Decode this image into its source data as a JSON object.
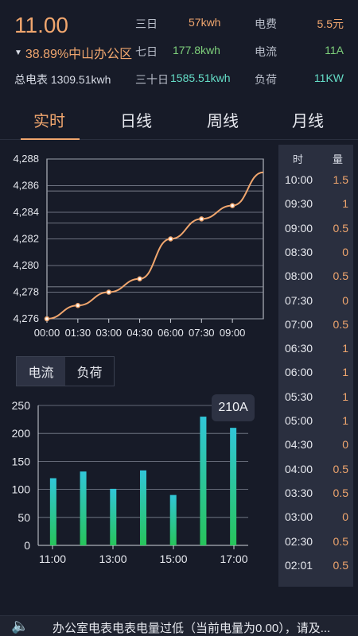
{
  "header": {
    "main_value": "11.00",
    "percent_location": "38.89%中山办公区",
    "total_meter": "总电表 1309.51kwh",
    "stats": [
      {
        "label": "三日",
        "value": "57kwh",
        "color": "orange"
      },
      {
        "label": "七日",
        "value": "177.8kwh",
        "color": "green"
      },
      {
        "label": "三十日",
        "value": "1585.51kwh",
        "color": "teal"
      }
    ],
    "stats2": [
      {
        "label": "电费",
        "value": "5.5元",
        "color": "orange"
      },
      {
        "label": "电流",
        "value": "11A",
        "color": "green"
      },
      {
        "label": "负荷",
        "value": "11KW",
        "color": "teal"
      }
    ]
  },
  "tabs": [
    "实时",
    "日线",
    "周线",
    "月线"
  ],
  "side_table": {
    "col_time": "时",
    "col_value": "量",
    "rows": [
      {
        "t": "10:00",
        "v": "1.5"
      },
      {
        "t": "09:30",
        "v": "1"
      },
      {
        "t": "09:00",
        "v": "0.5"
      },
      {
        "t": "08:30",
        "v": "0"
      },
      {
        "t": "08:00",
        "v": "0.5"
      },
      {
        "t": "07:30",
        "v": "0"
      },
      {
        "t": "07:00",
        "v": "0.5"
      },
      {
        "t": "06:30",
        "v": "1"
      },
      {
        "t": "06:00",
        "v": "1"
      },
      {
        "t": "05:30",
        "v": "1"
      },
      {
        "t": "05:00",
        "v": "1"
      },
      {
        "t": "04:30",
        "v": "0"
      },
      {
        "t": "04:00",
        "v": "0.5"
      },
      {
        "t": "03:30",
        "v": "0.5"
      },
      {
        "t": "03:00",
        "v": "0"
      },
      {
        "t": "02:30",
        "v": "0.5"
      },
      {
        "t": "02:01",
        "v": "0.5"
      }
    ]
  },
  "subtabs": [
    "电流",
    "负荷"
  ],
  "tooltip": "210A",
  "footer_text": "办公室电表电表电量过低（当前电量为0.00），请及...",
  "chart_data": [
    {
      "type": "line",
      "x": [
        "00:00",
        "01:30",
        "03:00",
        "04:30",
        "06:00",
        "07:30",
        "09:00",
        "10:00"
      ],
      "y": [
        4276,
        4277,
        4278,
        4279,
        4282,
        4283.5,
        4284.5,
        4287
      ],
      "xticks": [
        "00:00",
        "01:30",
        "03:00",
        "04:30",
        "06:00",
        "07:30",
        "09:00"
      ],
      "yticks": [
        "4,276",
        "4,278",
        "4,280",
        "4,282",
        "4,284",
        "4,286",
        "4,288"
      ],
      "ylim": [
        4276,
        4288
      ],
      "line_color": "#f0a66e"
    },
    {
      "type": "bar",
      "values": [
        120,
        132,
        101,
        134,
        90,
        230,
        210
      ],
      "xticks": [
        "11:00",
        "13:00",
        "15:00",
        "17:00"
      ],
      "yticks": [
        "0",
        "50",
        "100",
        "150",
        "200",
        "250"
      ],
      "ylim": [
        0,
        250
      ],
      "color_top": "#31c6d8",
      "color_bottom": "#27c45a"
    }
  ]
}
